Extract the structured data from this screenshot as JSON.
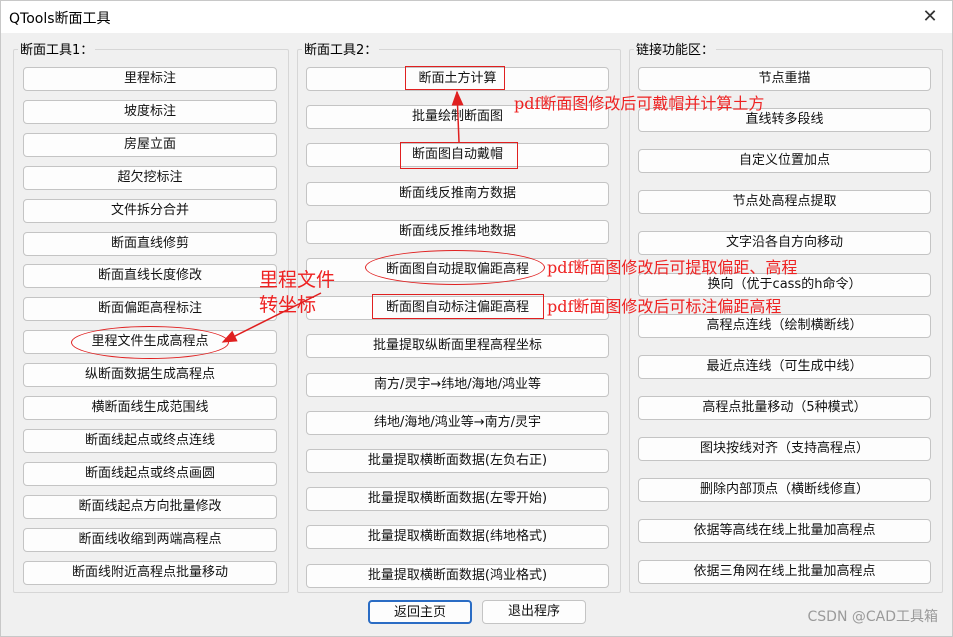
{
  "window": {
    "title": "QTools断面工具",
    "close_glyph": "✕"
  },
  "groups": {
    "tools1": "断面工具1：",
    "tools2": "断面工具2：",
    "links": "链接功能区："
  },
  "col1": [
    "里程标注",
    "坡度标注",
    "房屋立面",
    "超欠挖标注",
    "文件拆分合并",
    "断面直线修剪",
    "断面直线长度修改",
    "断面偏距高程标注",
    "里程文件生成高程点",
    "纵断面数据生成高程点",
    "横断面线生成范围线",
    "断面线起点或终点连线",
    "断面线起点或终点画圆",
    "断面线起点方向批量修改",
    "断面线收缩到两端高程点",
    "断面线附近高程点批量移动"
  ],
  "col2": [
    "断面土方计算",
    "批量绘制断面图",
    "断面图自动戴帽",
    "断面线反推南方数据",
    "断面线反推纬地数据",
    "断面图自动提取偏距高程",
    "断面图自动标注偏距高程",
    "批量提取纵断面里程高程坐标",
    "南方/灵宇→纬地/海地/鸿业等",
    "纬地/海地/鸿业等→南方/灵宇",
    "批量提取横断面数据(左负右正)",
    "批量提取横断面数据(左零开始)",
    "批量提取横断面数据(纬地格式)",
    "批量提取横断面数据(鸿业格式)"
  ],
  "col3": [
    "节点重描",
    "直线转多段线",
    "自定义位置加点",
    "节点处高程点提取",
    "文字沿各自方向移动",
    "换向（优于cass的h命令）",
    "高程点连线（绘制横断线）",
    "最近点连线（可生成中线）",
    "高程点批量移动（5种模式）",
    "图块按线对齐（支持高程点）",
    "删除内部顶点（横断线修直）",
    "依据等高线在线上批量加高程点",
    "依据三角网在线上批量加高程点"
  ],
  "bottom": {
    "home": "返回主页",
    "exit": "退出程序"
  },
  "annotations": {
    "a1": "pdf断面图修改后可戴帽并计算土方",
    "a2": "pdf断面图修改后可提取偏距、高程",
    "a3": "pdf断面图修改后可标注偏距高程",
    "a4_line1": "里程文件",
    "a4_line2": "转坐标"
  },
  "watermark": "CSDN @CAD工具箱",
  "colors": {
    "annotation": "#ee2222",
    "background": "#f0f0f0"
  }
}
